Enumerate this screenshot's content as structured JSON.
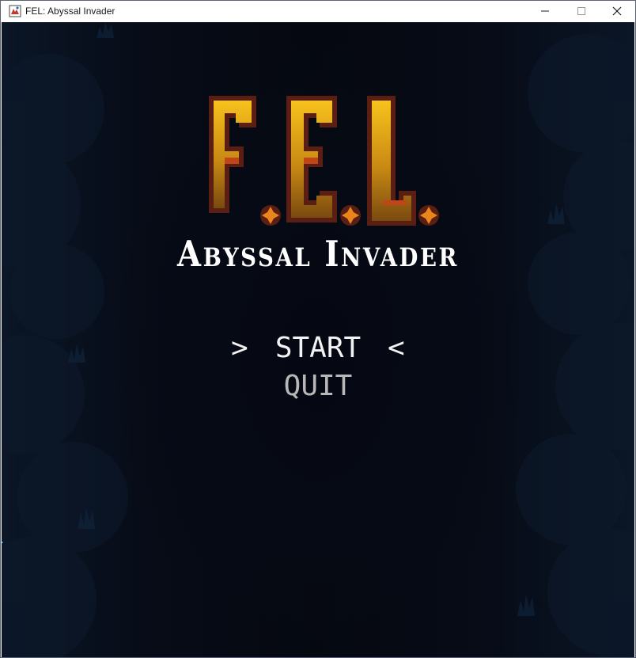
{
  "window": {
    "title": "FEL: Abyssal Invader",
    "minimize_icon": "minimize-icon",
    "maximize_icon": "maximize-icon",
    "close_icon": "close-icon"
  },
  "logo": {
    "letters": "F.E.L.",
    "subtitle": "Abyssal Invader",
    "colors": {
      "gold_top": "#f2b21b",
      "gold_bottom": "#8a5a12",
      "outline": "#5a1e12",
      "gem": "#e07a1a"
    }
  },
  "menu": {
    "start_label": "START",
    "quit_label": "QUIT",
    "selected": "START",
    "cursor_left": ">",
    "cursor_right": "<"
  },
  "colors": {
    "background": "#05080f",
    "menu_active": "#f2f2f2",
    "menu_inactive": "#b8b8b8"
  }
}
